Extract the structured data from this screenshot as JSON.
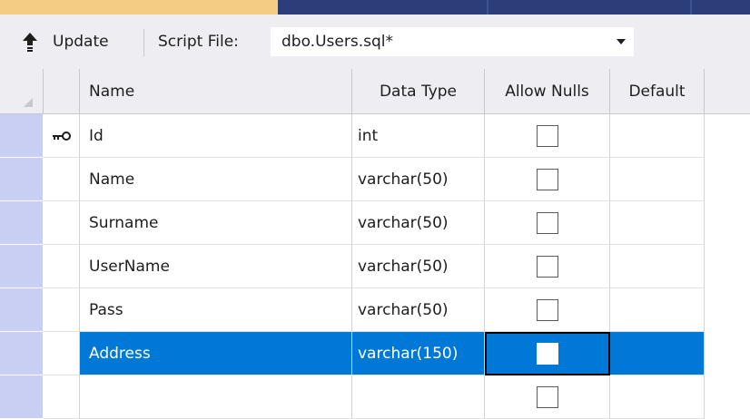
{
  "toolbar": {
    "update_label": "Update",
    "script_file_label": "Script File:",
    "script_file_value": "dbo.Users.sql*"
  },
  "columns": [
    "Name",
    "Data Type",
    "Allow Nulls",
    "Default"
  ],
  "rows": [
    {
      "name": "Id",
      "data_type": "int",
      "allow_nulls": false,
      "primary_key": true
    },
    {
      "name": "Name",
      "data_type": "varchar(50)",
      "allow_nulls": false,
      "primary_key": false
    },
    {
      "name": "Surname",
      "data_type": "varchar(50)",
      "allow_nulls": false,
      "primary_key": false
    },
    {
      "name": "UserName",
      "data_type": "varchar(50)",
      "allow_nulls": false,
      "primary_key": false
    },
    {
      "name": "Pass",
      "data_type": "varchar(50)",
      "allow_nulls": false,
      "primary_key": false
    },
    {
      "name": "Address",
      "data_type": "varchar(150)",
      "allow_nulls": false,
      "primary_key": false,
      "selected": true
    },
    {
      "name": "",
      "data_type": "",
      "allow_nulls": false,
      "primary_key": false
    }
  ],
  "icons": {
    "update": "upload-arrow-icon",
    "dropdown": "chevron-down-icon",
    "primary_key": "key-icon"
  },
  "colors": {
    "selection": "#0078d7",
    "row_header": "#c8cff2",
    "toolbar_bg": "#eeeef2",
    "active_tab": "#f5cc84",
    "tab_strip": "#2c3e7a"
  }
}
